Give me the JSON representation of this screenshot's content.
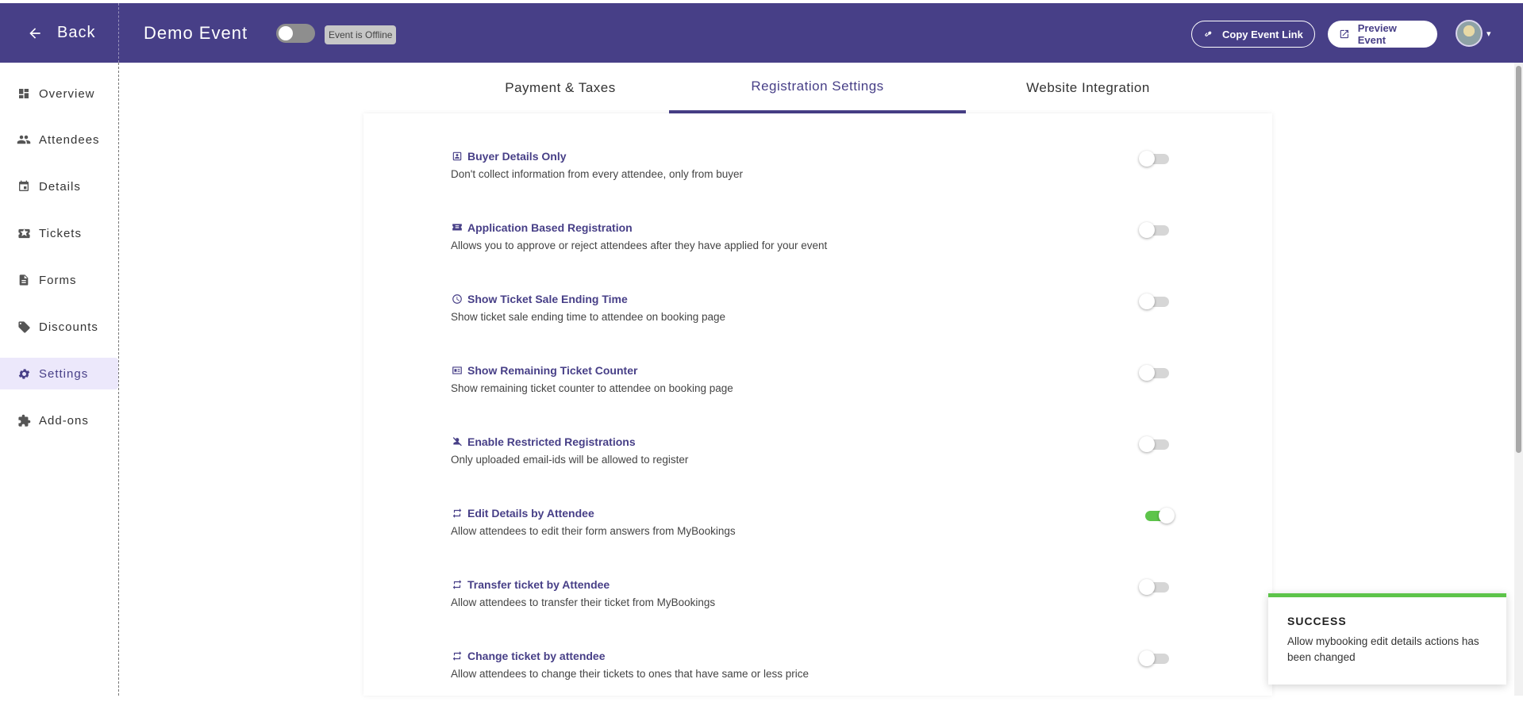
{
  "header": {
    "back_label": "Back",
    "event_title": "Demo Event",
    "status_badge": "Event is Offline",
    "copy_link_label": "Copy Event Link",
    "preview_label": "Preview Event",
    "brand_color": "#473f87"
  },
  "sidebar": {
    "items": [
      {
        "label": "Overview",
        "icon": "dashboard-icon"
      },
      {
        "label": "Attendees",
        "icon": "people-icon"
      },
      {
        "label": "Details",
        "icon": "calendar-icon"
      },
      {
        "label": "Tickets",
        "icon": "ticket-icon"
      },
      {
        "label": "Forms",
        "icon": "form-icon"
      },
      {
        "label": "Discounts",
        "icon": "tags-icon"
      },
      {
        "label": "Settings",
        "icon": "gear-icon",
        "active": true
      },
      {
        "label": "Add-ons",
        "icon": "puzzle-icon"
      }
    ]
  },
  "tabs": [
    {
      "label": "Payment & Taxes"
    },
    {
      "label": "Registration Settings",
      "active": true
    },
    {
      "label": "Website Integration"
    }
  ],
  "settings": [
    {
      "title": "Buyer Details Only",
      "desc": "Don't collect information from every attendee, only from buyer",
      "icon": "contact-card-icon",
      "enabled": false
    },
    {
      "title": "Application Based Registration",
      "desc": "Allows you to approve or reject attendees after they have applied for your event",
      "icon": "ticket-stack-icon",
      "enabled": false
    },
    {
      "title": "Show Ticket Sale Ending Time",
      "desc": "Show ticket sale ending time to attendee on booking page",
      "icon": "clock-icon",
      "enabled": false
    },
    {
      "title": "Show Remaining Ticket Counter",
      "desc": "Show remaining ticket counter to attendee on booking page",
      "icon": "counter-icon",
      "enabled": false
    },
    {
      "title": "Enable Restricted Registrations",
      "desc": "Only uploaded email-ids will be allowed to register",
      "icon": "person-off-icon",
      "enabled": false
    },
    {
      "title": "Edit Details by Attendee",
      "desc": "Allow attendees to edit their form answers from MyBookings",
      "icon": "repeat-icon",
      "enabled": true
    },
    {
      "title": "Transfer ticket by Attendee",
      "desc": "Allow attendees to transfer their ticket from MyBookings",
      "icon": "repeat-icon",
      "enabled": false
    },
    {
      "title": "Change ticket by attendee",
      "desc": "Allow attendees to change their tickets to ones that have same or less price",
      "icon": "repeat-icon",
      "enabled": false
    }
  ],
  "toast": {
    "title": "SUCCESS",
    "message": "Allow mybooking edit details actions has been changed",
    "accent": "#5dc44a"
  }
}
